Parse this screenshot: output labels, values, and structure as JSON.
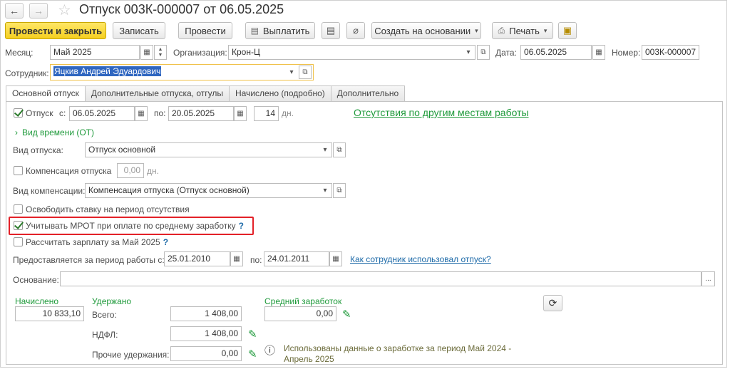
{
  "window": {
    "title": "Отпуск 003К-000007 от 06.05.2025"
  },
  "toolbar": {
    "post_close": "Провести и закрыть",
    "write": "Записать",
    "post": "Провести",
    "pay": "Выплатить",
    "create_based": "Создать на основании",
    "print": "Печать"
  },
  "header": {
    "month_label": "Месяц:",
    "month_value": "Май 2025",
    "org_label": "Организация:",
    "org_value": "Крон-Ц",
    "date_label": "Дата:",
    "date_value": "06.05.2025",
    "number_label": "Номер:",
    "number_value": "003К-000007",
    "employee_label": "Сотрудник:",
    "employee_value": "Яцкив Андрей Эдуардович"
  },
  "tabs": [
    {
      "label": "Основной отпуск"
    },
    {
      "label": "Дополнительные отпуска, отгулы"
    },
    {
      "label": "Начислено (подробно)"
    },
    {
      "label": "Дополнительно"
    }
  ],
  "vacation": {
    "checkbox_label": "Отпуск",
    "from_label": "с:",
    "from_value": "06.05.2025",
    "to_label": "по:",
    "to_value": "20.05.2025",
    "days_value": "14",
    "days_unit": "дн.",
    "other_absences_link": "Отсутствия по другим местам работы",
    "time_type_label": "Вид времени (ОТ)",
    "vacation_type_label": "Вид отпуска:",
    "vacation_type_value": "Отпуск основной",
    "compensation_label": "Компенсация отпуска",
    "compensation_days": "0,00",
    "compensation_unit": "дн.",
    "compensation_type_label": "Вид компенсации:",
    "compensation_type_value": "Компенсация отпуска (Отпуск основной)",
    "free_rate_label": "Освободить ставку на период отсутствия",
    "mrot_label": "Учитывать МРОТ при оплате по среднему заработку",
    "calc_salary_label": "Рассчитать зарплату за Май 2025",
    "period_label": "Предоставляется за период работы с:",
    "period_from": "25.01.2010",
    "period_to_label": "по:",
    "period_to": "24.01.2011",
    "usage_link": "Как сотрудник использовал отпуск?",
    "basis_label": "Основание:",
    "basis_value": ""
  },
  "totals": {
    "accrued_label": "Начислено",
    "accrued_value": "10 833,10",
    "withheld_label": "Удержано",
    "total_label": "Всего:",
    "total_value": "1 408,00",
    "ndfl_label": "НДФЛ:",
    "ndfl_value": "1 408,00",
    "other_label": "Прочие удержания:",
    "other_value": "0,00",
    "avg_label": "Средний заработок",
    "avg_value": "0,00",
    "info_text_line1": "Использованы данные о заработке за период Май 2024 -",
    "info_text_line2": "Апрель 2025"
  },
  "icons": {
    "back": "←",
    "forward": "→",
    "star": "☆",
    "calendar": "▦",
    "refresh": "⟳",
    "pencil": "✎",
    "info": "ⓘ",
    "ellipsis": "..."
  }
}
